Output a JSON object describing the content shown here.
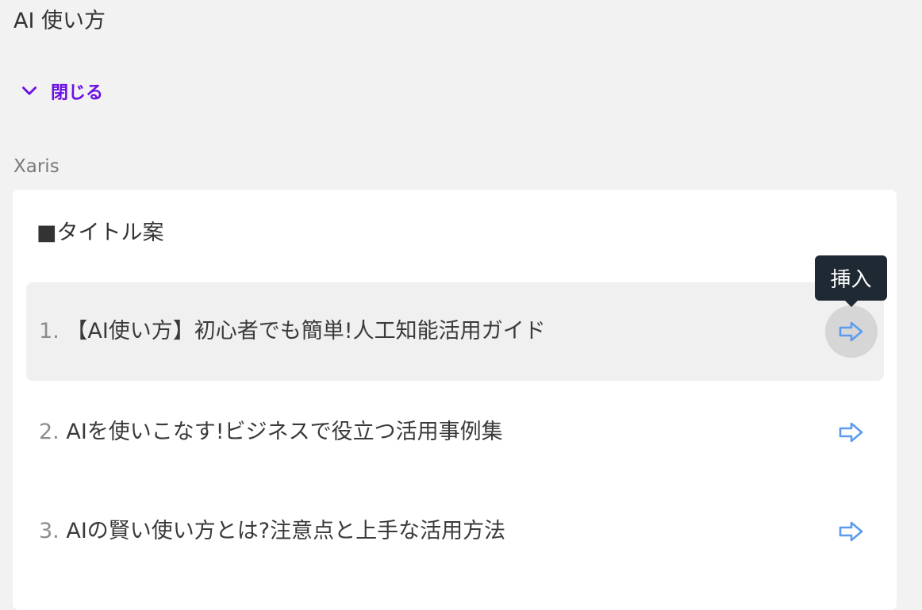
{
  "prompt": {
    "title": "AI 使い方"
  },
  "toggle": {
    "label": "閉じる",
    "icon": "chevron-down-icon"
  },
  "author": {
    "name": "Xaris"
  },
  "card": {
    "heading": "■タイトル案",
    "items": [
      {
        "number": "1.",
        "text": "【AI使い方】初心者でも簡単!人工知能活用ガイド"
      },
      {
        "number": "2.",
        "text": "AIを使いこなす!ビジネスで役立つ活用事例集"
      },
      {
        "number": "3.",
        "text": "AIの賢い使い方とは?注意点と上手な活用方法"
      }
    ],
    "insert_icon": "arrow-right-icon"
  },
  "tooltip": {
    "label": "挿入"
  },
  "colors": {
    "accent": "#6b0fe6",
    "insert_icon": "#5b9cf0",
    "tooltip_bg": "#1f2933"
  }
}
